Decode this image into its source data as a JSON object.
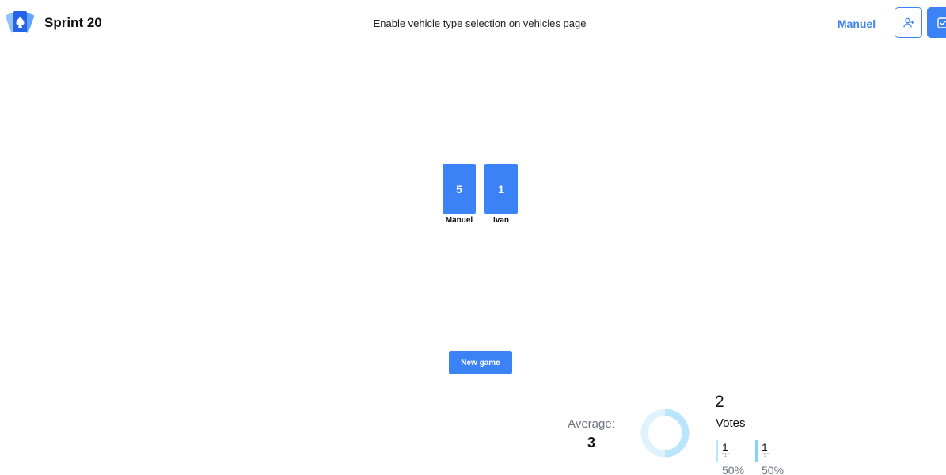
{
  "header": {
    "logo_icon": "spade-cards-icon",
    "title": "Sprint 20",
    "story_title": "Enable vehicle type selection on vehicles page",
    "user_name": "Manuel",
    "invite_icon": "user-plus-icon",
    "stories_icon": "checkbox-icon"
  },
  "table": {
    "cards": [
      {
        "player": "Manuel",
        "value": "5"
      },
      {
        "player": "Ivan",
        "value": "1"
      }
    ],
    "new_game_label": "New game"
  },
  "results": {
    "average_label": "Average:",
    "average_value": "3",
    "votes_count": "2",
    "votes_label": "Votes",
    "breakdown": [
      {
        "count": "1",
        "key": "\"1\"",
        "percent": "50%",
        "share": 0.5,
        "color": "#bae6fd"
      },
      {
        "count": "1",
        "key": "\"5\"",
        "percent": "50%",
        "share": 0.5,
        "color": "#7dd3fc"
      }
    ]
  },
  "colors": {
    "accent": "#3b82f6",
    "donut_light": "#e0f2fe",
    "donut_dark": "#bae6fd"
  }
}
